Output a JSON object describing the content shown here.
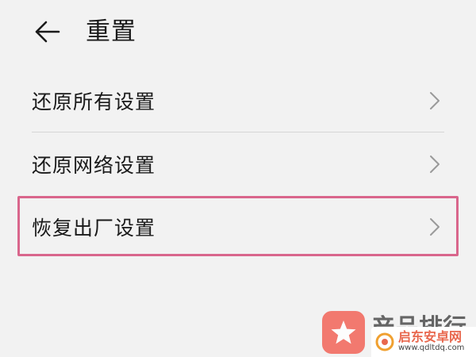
{
  "header": {
    "back_icon": "arrow-left-icon",
    "title": "重置"
  },
  "items": [
    {
      "label": "还原所有设置",
      "icon": "chevron-right-icon"
    },
    {
      "label": "还原网络设置",
      "icon": "chevron-right-icon"
    },
    {
      "label": "恢复出厂设置",
      "icon": "chevron-right-icon",
      "highlighted": true
    }
  ],
  "watermark": {
    "title": "产品排行",
    "site_name": "启东安卓网",
    "site_url": "www.qdltdq.com",
    "logo_icon": "star-icon"
  },
  "colors": {
    "background": "#f2f2f2",
    "highlight": "#d9668c",
    "logo": "#f26d61",
    "chevron": "#9a9a9a"
  }
}
